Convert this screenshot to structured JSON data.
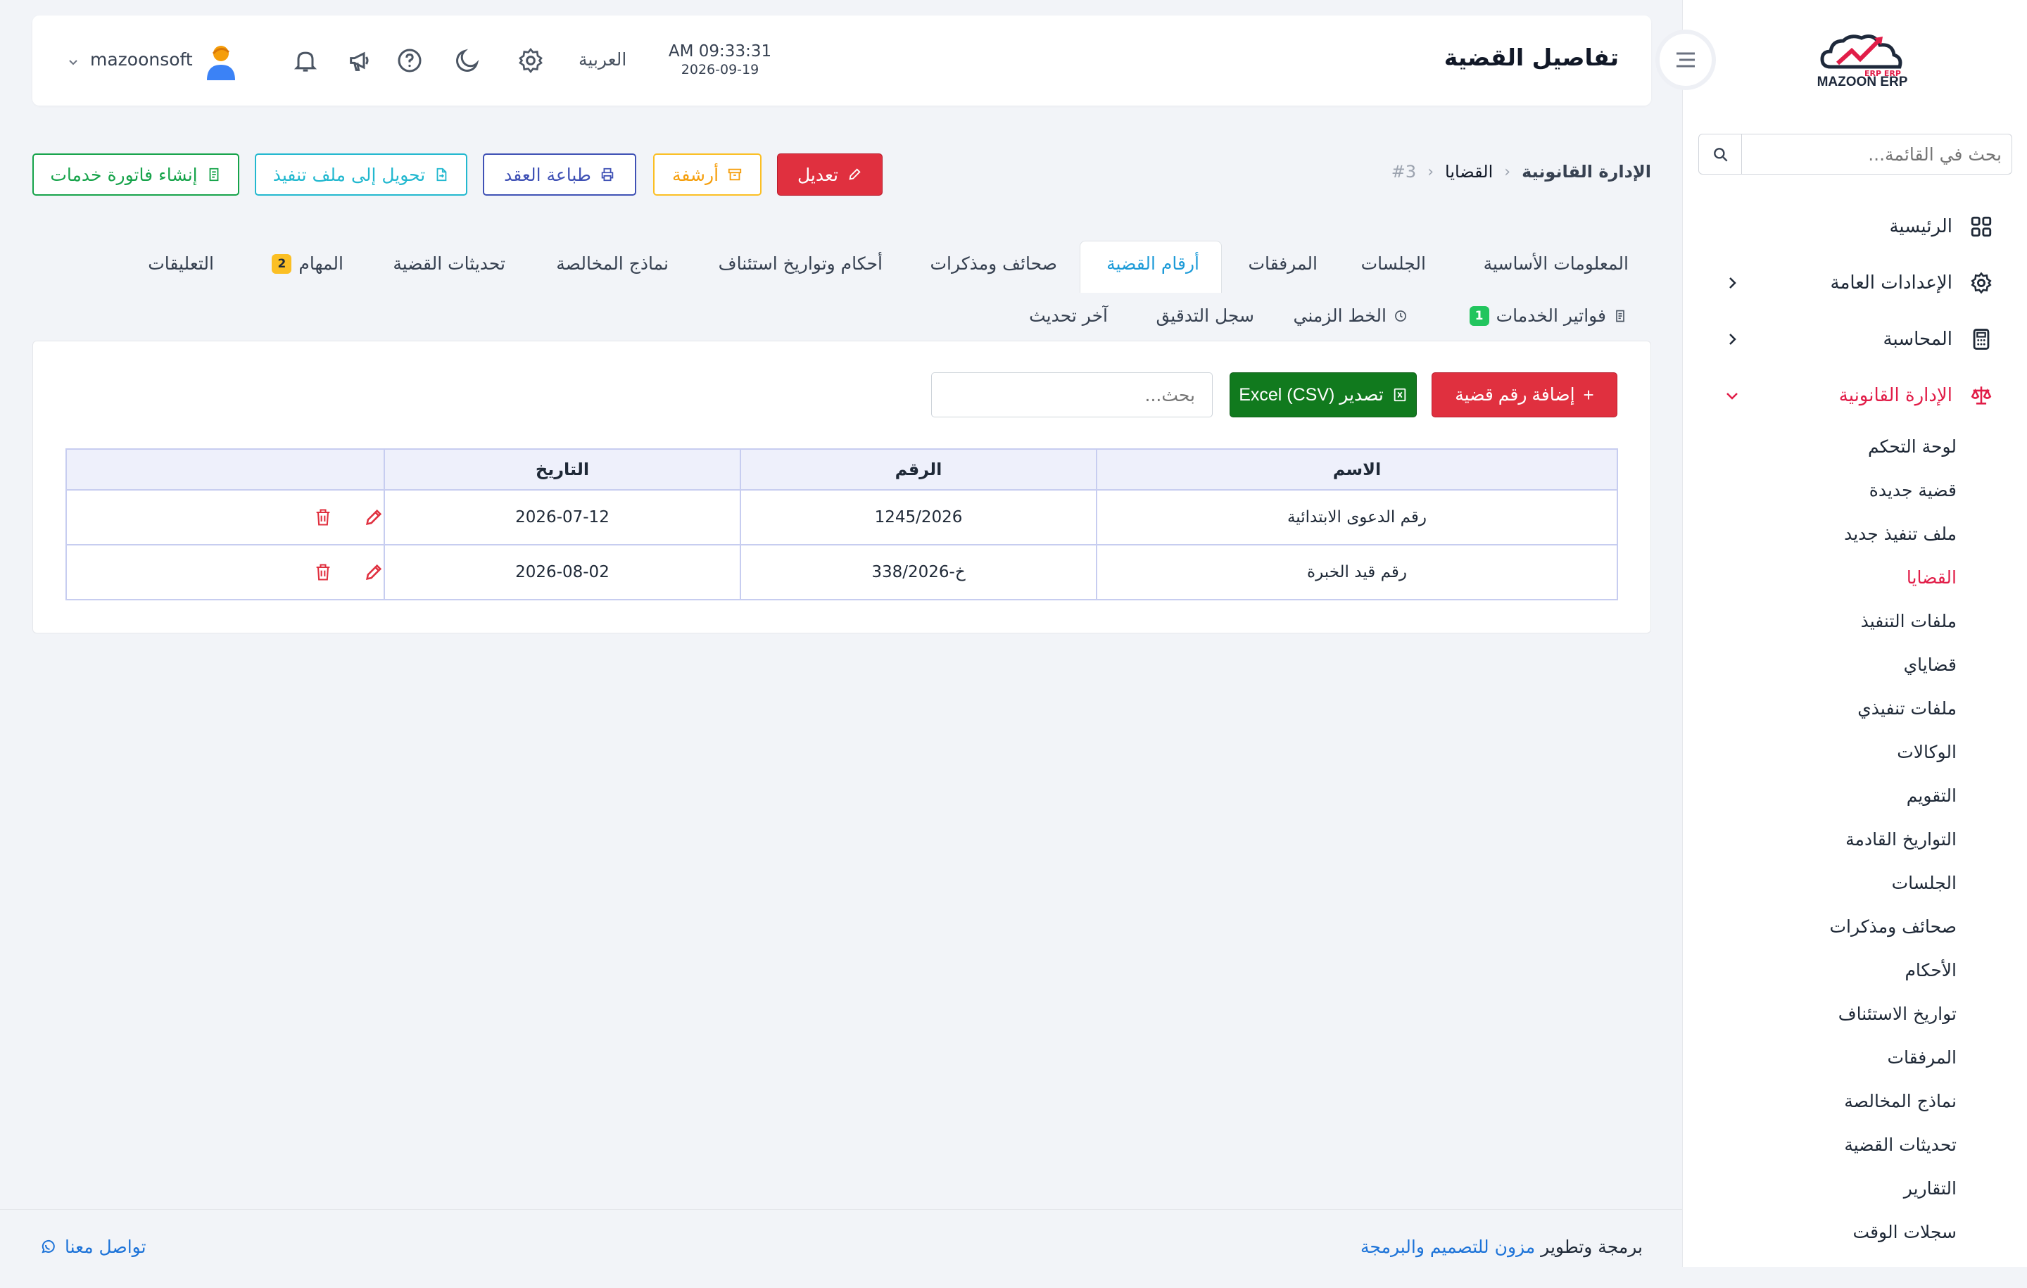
{
  "app": {
    "title": "تفاصيل القضية",
    "logo_text": "MAZOON ERP",
    "logo_tag": "ERP ERP"
  },
  "sidebar": {
    "search_placeholder": "بحث في القائمة...",
    "main": [
      {
        "label": "الرئيسية",
        "icon": "grid-icon"
      },
      {
        "label": "الإعدادات العامة",
        "icon": "gear-icon"
      },
      {
        "label": "المحاسبة",
        "icon": "calculator-icon"
      },
      {
        "label": "الإدارة القانونية",
        "icon": "scales-icon"
      }
    ],
    "legal_items": [
      "لوحة التحكم",
      "قضية جديدة",
      "ملف تنفيذ جديد",
      "القضايا",
      "ملفات التنفيذ",
      "قضاياي",
      "ملفات تنفيذي",
      "الوكالات",
      "التقويم",
      "التواريخ القادمة",
      "الجلسات",
      "صحائف ومذكرات",
      "الأحكام",
      "تواريخ الاستئناف",
      "المرفقات",
      "نماذج المخالصة",
      "تحديثات القضية",
      "التقارير",
      "سجلات الوقت"
    ],
    "active_item": "القضايا"
  },
  "topbar": {
    "time": "AM 09:33:31",
    "date": "2026-09-19",
    "language": "العربية",
    "username": "mazoonsoft"
  },
  "breadcrumb": {
    "root": "الإدارة القانونية",
    "section": "القضايا",
    "current": "#3"
  },
  "actions": {
    "edit": "تعديل",
    "archive": "أرشفة",
    "print_contract": "طباعة العقد",
    "convert": "تحويل إلى ملف تنفيذ",
    "create_invoice": "إنشاء فاتورة خدمات"
  },
  "tabs": {
    "row1": [
      {
        "label": "المعلومات الأساسية"
      },
      {
        "label": "الجلسات"
      },
      {
        "label": "المرفقات"
      },
      {
        "label": "أرقام القضية",
        "active": true
      },
      {
        "label": "صحائف ومذكرات"
      },
      {
        "label": "أحكام وتواريخ استئناف"
      },
      {
        "label": "نماذج المخالصة"
      },
      {
        "label": "تحديثات القضية"
      },
      {
        "label": "المهام",
        "badge": "2"
      },
      {
        "label": "التعليقات"
      }
    ],
    "row2": [
      {
        "label": "فواتير الخدمات",
        "badge": "1"
      },
      {
        "label": "الخط الزمني"
      },
      {
        "label": "سجل التدقيق"
      },
      {
        "label": "آخر تحديث"
      }
    ]
  },
  "panel": {
    "add_button": "إضافة رقم قضية",
    "export_button": "تصدير (CSV) Excel",
    "search_placeholder": "بحث..."
  },
  "table": {
    "headers": [
      "الاسم",
      "الرقم",
      "التاريخ",
      ""
    ],
    "rows": [
      {
        "name": "رقم الدعوى الابتدائية",
        "number": "1245/2026",
        "date": "2026-07-12"
      },
      {
        "name": "رقم قيد الخبرة",
        "number": "خ-338/2026",
        "date": "2026-08-02"
      }
    ]
  },
  "footer": {
    "prefix": "برمجة وتطوير",
    "company": "مزون للتصميم والبرمجة",
    "contact": "تواصل معنا"
  },
  "colors": {
    "accent_red": "#e0303f",
    "active_blue": "#1d9bd8",
    "export_green": "#117a1e"
  }
}
